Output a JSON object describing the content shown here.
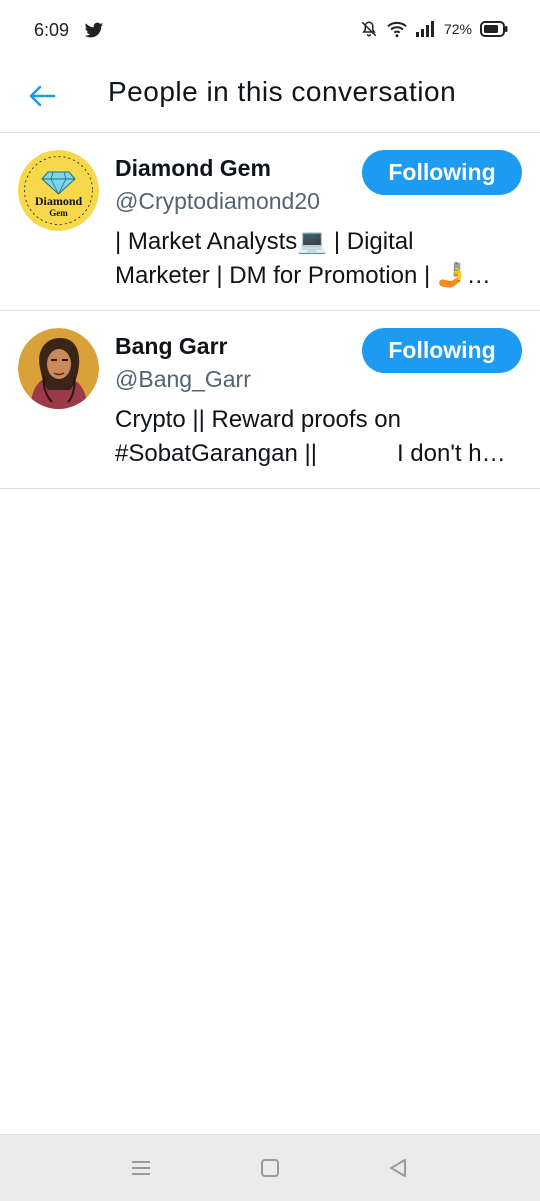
{
  "status_bar": {
    "time": "6:09",
    "battery": "72%"
  },
  "header": {
    "title": "People in this conversation"
  },
  "users": [
    {
      "name": "Diamond Gem",
      "handle": "@Cryptodiamond20",
      "bio_line1": "| Market Analysts💻 | Digital",
      "bio_line2": "Marketer | DM for Promotion | 🤳…",
      "follow_label": "Following",
      "avatar_text1": "Diamond",
      "avatar_text2": "Gem"
    },
    {
      "name": "Bang Garr",
      "handle": "@Bang_Garr",
      "bio_line1": "Crypto || Reward proofs on",
      "bio_line2": "#SobatGarangan ||            I don't h…",
      "follow_label": "Following"
    }
  ],
  "colors": {
    "accent": "#1d9bf0",
    "text": "#0f1419",
    "secondary": "#536471",
    "avatar1_bg": "#f6d84a"
  }
}
